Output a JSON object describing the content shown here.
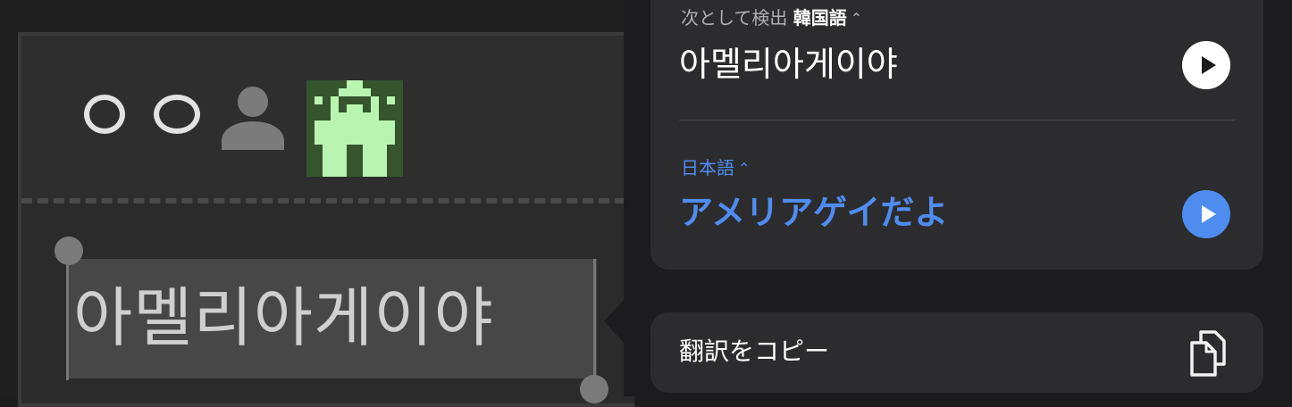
{
  "translation": {
    "source_lang_prefix": "次として検出",
    "source_lang": "韓国語",
    "source_text": "아멜리아게이야",
    "target_lang": "日本語",
    "target_text": "アメリアゲイだよ",
    "copy_label": "翻訳をコピー"
  },
  "background_app": {
    "selected_text": "아멜리아게이야"
  },
  "icons": {
    "chevron": "chevron-up-down-icon",
    "play": "play-icon",
    "copy": "copy-icon",
    "person": "person-icon",
    "invader": "pixel-invader-icon"
  },
  "colors": {
    "accent": "#4f8cf0",
    "card": "#2c2c2e",
    "background": "#1c1c1e"
  }
}
